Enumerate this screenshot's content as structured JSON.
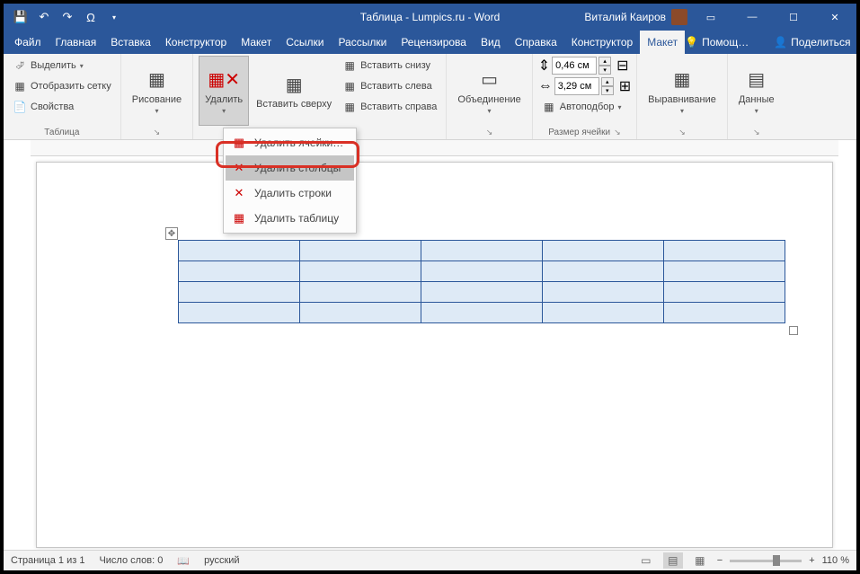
{
  "title": "Таблица - Lumpics.ru  -  Word",
  "user": "Виталий Каиров",
  "tabs": {
    "file": "Файл",
    "home": "Главная",
    "insert": "Вставка",
    "design": "Конструктор",
    "layout1": "Макет",
    "refs": "Ссылки",
    "mail": "Рассылки",
    "review": "Рецензирова",
    "view": "Вид",
    "help": "Справка",
    "tbl_design": "Конструктор",
    "tbl_layout": "Макет",
    "tell_me": "Помощ…",
    "share": "Поделиться"
  },
  "ribbon": {
    "table": {
      "select": "Выделить",
      "gridlines": "Отобразить сетку",
      "properties": "Свойства",
      "label": "Таблица"
    },
    "draw": {
      "btn": "Рисование",
      "label": "↘"
    },
    "rows_cols": {
      "delete": "Удалить",
      "insert_above": "Вставить сверху",
      "insert_below": "Вставить снизу",
      "insert_left": "Вставить слева",
      "insert_right": "Вставить справа",
      "label": "↘"
    },
    "merge": {
      "btn": "Объединение",
      "label": "↘"
    },
    "cell_size": {
      "height": "0,46 см",
      "width": "3,29 см",
      "autofit": "Автоподбор",
      "label": "Размер ячейки"
    },
    "align": {
      "btn": "Выравнивание",
      "label": "↘"
    },
    "data": {
      "btn": "Данные",
      "label": "↘"
    }
  },
  "delete_menu": {
    "cells": "Удалить ячейки…",
    "columns": "Удалить столбцы",
    "rows": "Удалить строки",
    "table": "Удалить таблицу"
  },
  "status": {
    "page": "Страница 1 из 1",
    "words": "Число слов: 0",
    "lang": "русский",
    "zoom": "110 %"
  }
}
